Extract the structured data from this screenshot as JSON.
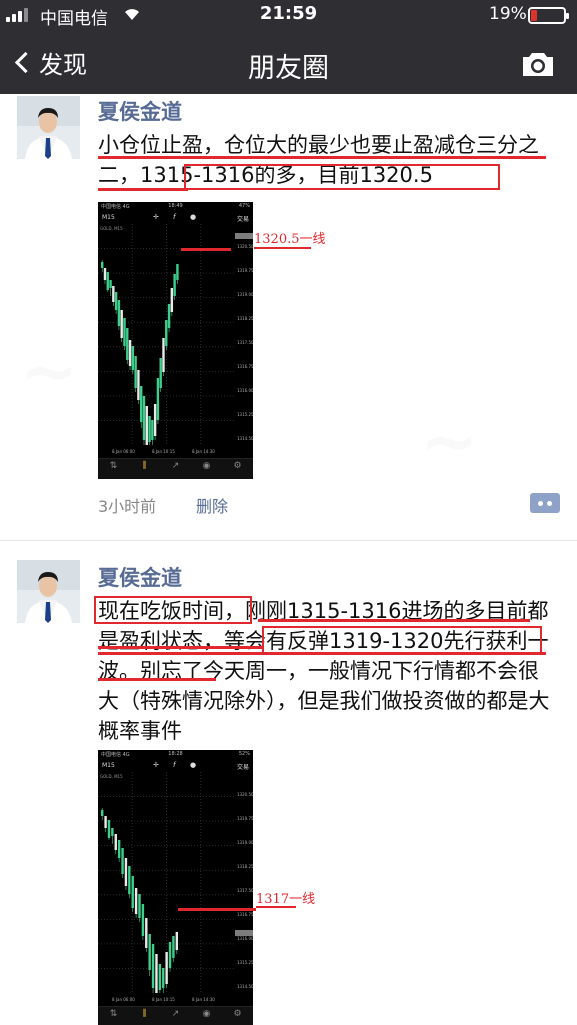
{
  "status_bar": {
    "carrier": "中国电信",
    "time": "21:59",
    "battery_percent": "19%",
    "battery_level": 0.19,
    "battery_color": "#e0342a"
  },
  "navbar": {
    "back_label": "发现",
    "title": "朋友圈",
    "right_icon": "camera-icon"
  },
  "colors": {
    "author": "#576b95",
    "annotation": "#e0282e",
    "bar_bg": "#2e2e33",
    "candle": "#3cd08c"
  },
  "posts": [
    {
      "author": "夏侯金道",
      "text": "小仓位止盈，仓位大的最少也要止盈减仓三分之二，1315-1316的多，目前1320.5",
      "time": "3小时前",
      "delete": "删除",
      "annotation": "1320.5一线",
      "screenshot": {
        "status_time": "18:49",
        "carrier": "中国电信 4G",
        "battery": "47%",
        "timeframe": "M15",
        "trade": "交易",
        "symbol": "GOLD, M15",
        "y_ticks": [
          "1320.50",
          "1319.75",
          "1319.00",
          "1318.25",
          "1317.50",
          "1316.75",
          "1316.00",
          "1315.25",
          "1314.50"
        ],
        "x_ticks": [
          "8 Jan 06:00",
          "8 Jan 10:15",
          "8 Jan 14:30"
        ],
        "tabs": [
          "行情",
          "图表",
          "交易",
          "历史",
          "设置"
        ],
        "candles": [
          [
            10,
            12,
            18,
            22
          ],
          [
            20,
            18,
            30,
            34
          ],
          [
            26,
            22,
            40,
            42
          ],
          [
            32,
            30,
            38,
            46
          ],
          [
            38,
            36,
            52,
            56
          ],
          [
            44,
            42,
            60,
            64
          ],
          [
            52,
            50,
            76,
            80
          ],
          [
            62,
            60,
            88,
            92
          ],
          [
            70,
            68,
            96,
            100
          ],
          [
            80,
            78,
            110,
            114
          ],
          [
            92,
            90,
            116,
            120
          ],
          [
            100,
            96,
            120,
            124
          ],
          [
            110,
            106,
            138,
            142
          ],
          [
            124,
            120,
            150,
            154
          ],
          [
            140,
            136,
            172,
            178
          ],
          [
            150,
            146,
            190,
            196
          ],
          [
            158,
            156,
            196,
            204
          ],
          [
            168,
            166,
            192,
            200
          ],
          [
            172,
            170,
            190,
            198
          ],
          [
            156,
            154,
            186,
            190
          ],
          [
            130,
            128,
            170,
            174
          ],
          [
            110,
            108,
            138,
            142
          ],
          [
            90,
            88,
            122,
            126
          ],
          [
            72,
            70,
            96,
            100
          ],
          [
            56,
            54,
            78,
            82
          ],
          [
            40,
            38,
            62,
            66
          ],
          [
            26,
            24,
            46,
            50
          ],
          [
            16,
            14,
            30,
            34
          ]
        ]
      }
    },
    {
      "author": "夏侯金道",
      "text": "现在吃饭时间，刚刚1315-1316进场的多目前都是盈利状态，等会有反弹1319-1320先行获利一波。别忘了今天周一，一般情况下行情都不会很大（特殊情况除外），但是我们做投资做的都是大概率事件",
      "annotation": "1317一线",
      "screenshot": {
        "status_time": "18:28",
        "carrier": "中国电信 4G",
        "battery": "52%",
        "timeframe": "M15",
        "trade": "交易",
        "symbol": "GOLD, M15",
        "y_ticks": [
          "1320.50",
          "1319.75",
          "1319.00",
          "1318.25",
          "1317.50",
          "1316.75",
          "1316.00",
          "1315.25",
          "1314.50"
        ],
        "x_ticks": [
          "8 Jan 06:00",
          "8 Jan 10:15",
          "8 Jan 14:30"
        ],
        "tabs": [
          "行情",
          "图表",
          "交易",
          "历史",
          "设置"
        ],
        "candles": [
          [
            10,
            12,
            18,
            22
          ],
          [
            20,
            18,
            30,
            34
          ],
          [
            26,
            22,
            40,
            42
          ],
          [
            32,
            30,
            38,
            46
          ],
          [
            38,
            36,
            52,
            56
          ],
          [
            44,
            42,
            60,
            64
          ],
          [
            52,
            50,
            76,
            80
          ],
          [
            62,
            60,
            88,
            92
          ],
          [
            70,
            68,
            96,
            100
          ],
          [
            80,
            78,
            110,
            114
          ],
          [
            92,
            90,
            116,
            120
          ],
          [
            100,
            96,
            120,
            124
          ],
          [
            110,
            106,
            138,
            142
          ],
          [
            124,
            120,
            150,
            154
          ],
          [
            140,
            136,
            172,
            178
          ],
          [
            150,
            146,
            190,
            196
          ],
          [
            158,
            156,
            196,
            204
          ],
          [
            168,
            166,
            192,
            200
          ],
          [
            172,
            170,
            190,
            198
          ],
          [
            156,
            154,
            186,
            190
          ],
          [
            146,
            144,
            170,
            174
          ],
          [
            140,
            138,
            160,
            164
          ],
          [
            136,
            134,
            152,
            156
          ]
        ]
      }
    }
  ]
}
